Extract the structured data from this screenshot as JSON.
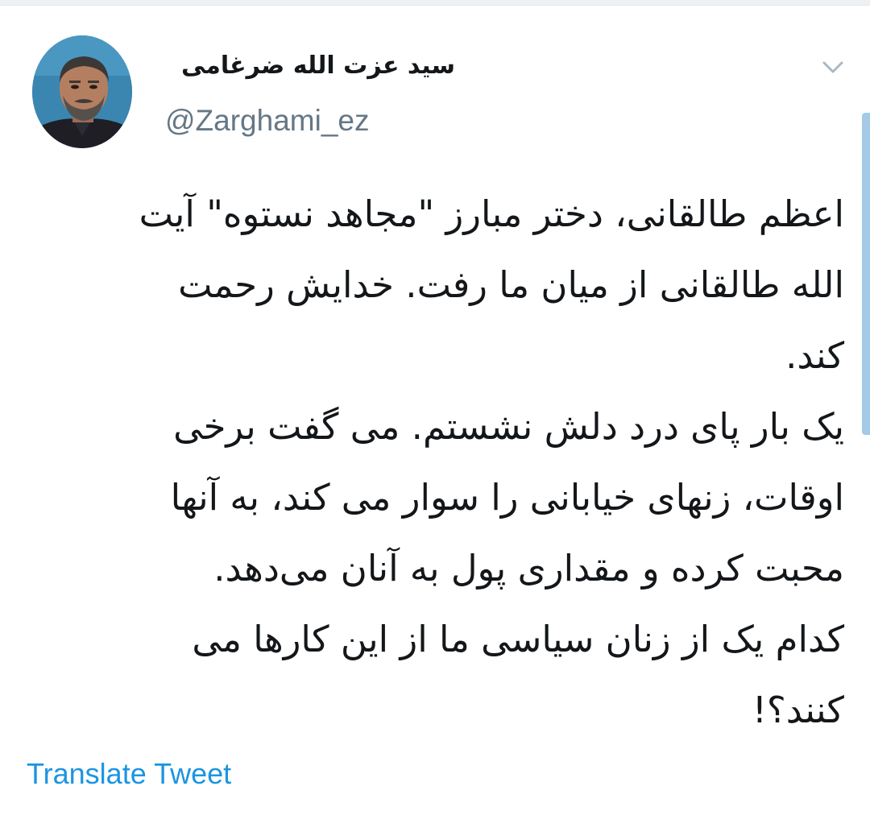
{
  "tweet": {
    "author": {
      "display_name": "سید عزت الله ضرغامی",
      "handle": "@Zarghami_ez",
      "avatar_icon": "user-avatar-photo"
    },
    "menu_icon": "chevron-down-icon",
    "text_lines": [
      "اعظم طالقانی، دختر مبارز  \"مجاهد نستوه\" آیت",
      "الله طالقانی از میان ما رفت. خدایش رحمت",
      "کند.",
      " یک بار پای درد دلش نشستم. می گفت برخی",
      "اوقات، زنهای خیابانی را سوار می کند، به آنها",
      "محبت کرده و مقداری پول به آنان می‌دهد.",
      "کدام یک از زنان سیاسی ما از این کارها می",
      "کنند؟!"
    ],
    "translate_label": "Translate Tweet"
  },
  "colors": {
    "handle": "#657786",
    "link": "#1b95e0",
    "text": "#14171a",
    "chevron": "#aab8c2"
  }
}
